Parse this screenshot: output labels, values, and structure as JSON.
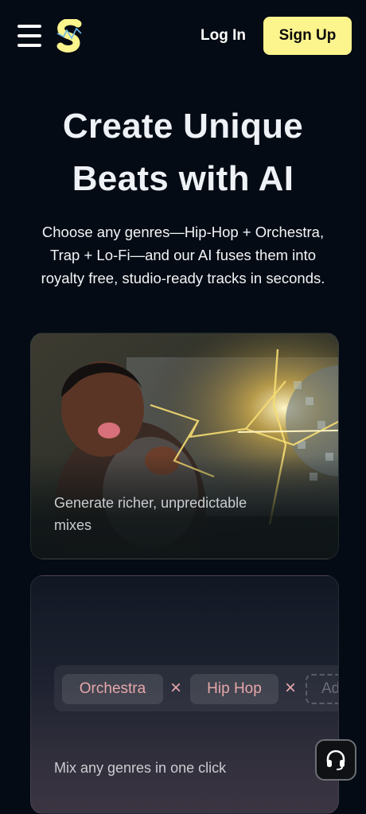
{
  "header": {
    "menu_icon": "hamburger-menu-icon",
    "logo_icon": "suno-style-s-logo",
    "login_label": "Log In",
    "signup_label": "Sign Up"
  },
  "hero": {
    "title_line1": "Create Unique",
    "title_line2": "Beats with AI",
    "subtitle_line1": "Choose any genres—Hip-Hop + Orchestra,",
    "subtitle_line2": "Trap + Lo-Fi—and our AI fuses them into",
    "subtitle_line3": "royalty free, studio-ready tracks in seconds."
  },
  "cards": [
    {
      "caption_line1": "Generate richer, unpredictable",
      "caption_line2": "mixes"
    },
    {
      "caption": "Mix any genres in one click",
      "chips": [
        "Orchestra",
        "Hip Hop"
      ],
      "chip_remove": "×",
      "add_placeholder": "Ad"
    }
  ],
  "support": {
    "icon": "headset-icon"
  },
  "colors": {
    "background": "#050b14",
    "signup_bg": "#fcf48d",
    "chip_text": "#e5a7a9"
  }
}
